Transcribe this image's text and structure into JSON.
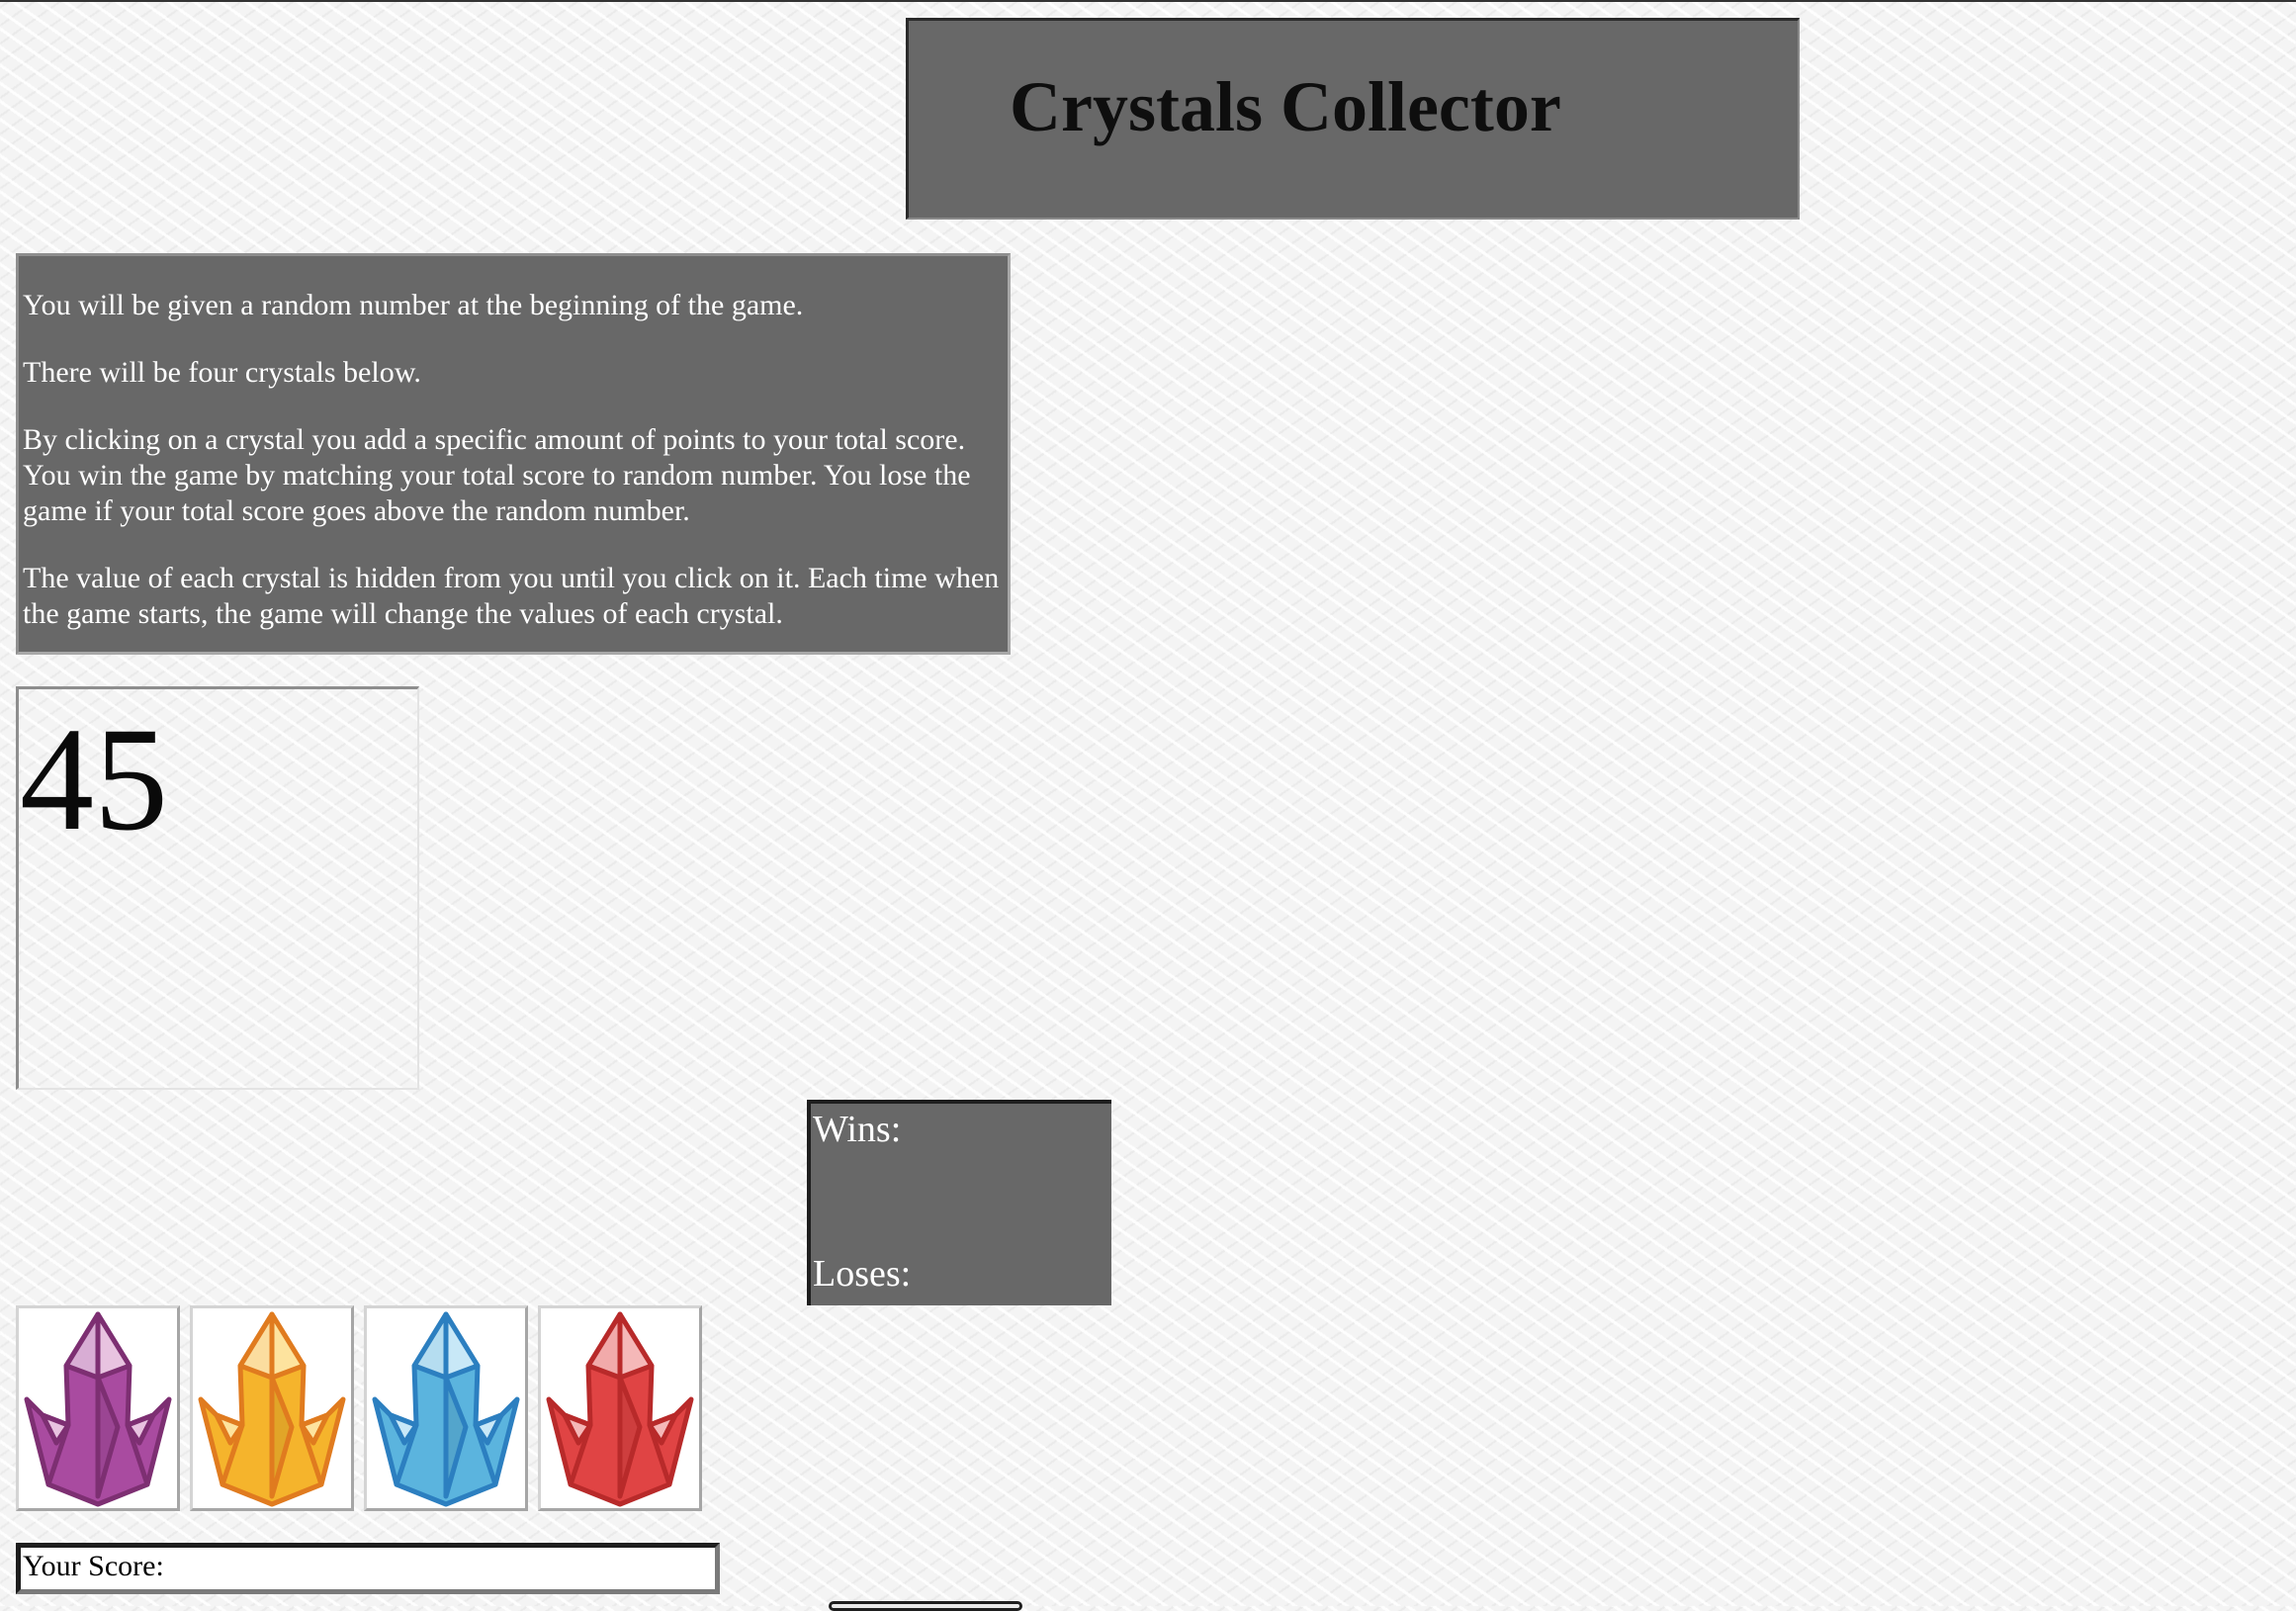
{
  "header": {
    "title": "Crystals Collector"
  },
  "instructions": {
    "paragraphs": [
      "You will be given a random number at the beginning of the game.",
      "There will be four crystals below.",
      "By clicking on a crystal you add a specific amount of points to your total score. You win the game by matching your total score to random number. You lose the game if your total score goes above the random number.",
      "The value of each crystal is hidden from you until you click on it. Each time when the game starts, the game will change the values of each crystal."
    ]
  },
  "target": {
    "value": "45"
  },
  "stats": {
    "wins_label": "Wins:",
    "loses_label": "Loses:"
  },
  "crystals": [
    {
      "name": "purple",
      "icon": "purple-crystal-icon",
      "fill": "#a94ba0",
      "light": "#e8c3e0",
      "stroke": "#7d2f72"
    },
    {
      "name": "orange",
      "icon": "orange-crystal-icon",
      "fill": "#f5b42c",
      "light": "#fde39e",
      "stroke": "#e07b1f"
    },
    {
      "name": "blue",
      "icon": "blue-crystal-icon",
      "fill": "#5bb4de",
      "light": "#c8e8f7",
      "stroke": "#2c7fc0"
    },
    {
      "name": "red",
      "icon": "red-crystal-icon",
      "fill": "#e04444",
      "light": "#f5b8b8",
      "stroke": "#b82a2a"
    }
  ],
  "score": {
    "label": "Your Score:"
  }
}
